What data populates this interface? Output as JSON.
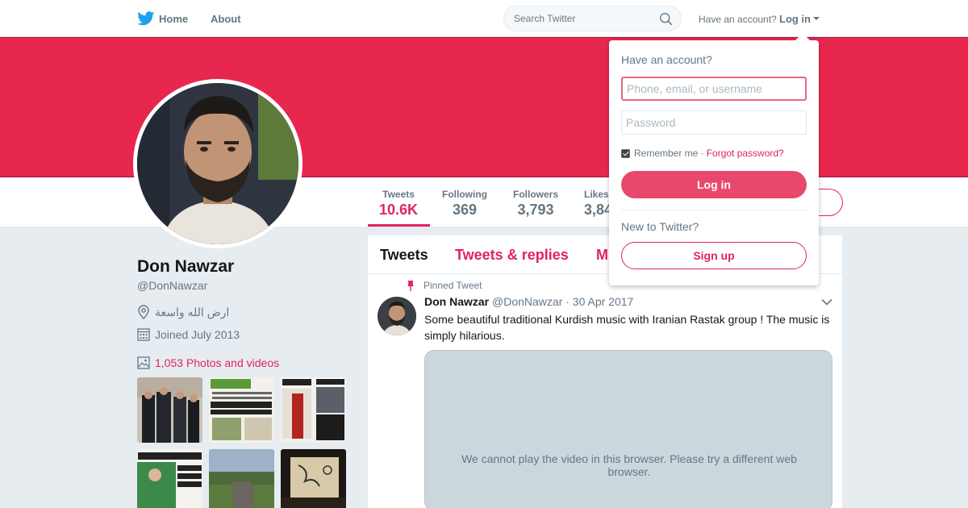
{
  "nav": {
    "home_label": "Home",
    "about_label": "About",
    "search_placeholder": "Search Twitter",
    "have_account": "Have an account?",
    "login_label": "Log in"
  },
  "colors": {
    "accent": "#e0245e",
    "banner": "#e8274f",
    "page_bg": "#e6ecf0"
  },
  "profile": {
    "name": "Don Nawzar",
    "handle": "@DonNawzar",
    "location": "ارض الله واسعة",
    "joined": "Joined July 2013",
    "photos": "1,053 Photos and videos"
  },
  "stats": [
    {
      "label": "Tweets",
      "value": "10.6K"
    },
    {
      "label": "Following",
      "value": "369"
    },
    {
      "label": "Followers",
      "value": "3,793"
    },
    {
      "label": "Likes",
      "value": "3,84"
    }
  ],
  "timeline": {
    "tabs": [
      "Tweets",
      "Tweets & replies",
      "M"
    ]
  },
  "tweet": {
    "pinned_label": "Pinned Tweet",
    "author_name": "Don Nawzar",
    "author_handle": "@DonNawzar · 30 Apr 2017",
    "text": "Some beautiful traditional Kurdish music with Iranian Rastak group ! The music is simply hilarious.",
    "video_message": "We cannot play the video in this browser. Please try a different web browser."
  },
  "login_dropdown": {
    "heading": "Have an account?",
    "username_placeholder": "Phone, email, or username",
    "password_placeholder": "Password",
    "remember_me": "Remember me ·",
    "forgot_password": "Forgot password?",
    "login_button": "Log in",
    "new_to_twitter": "New to Twitter?",
    "signup_button": "Sign up"
  }
}
